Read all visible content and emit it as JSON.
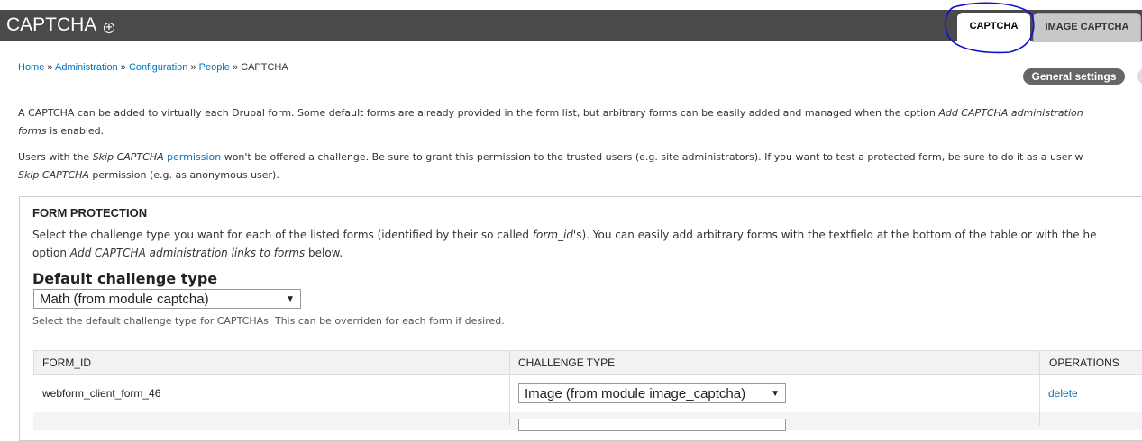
{
  "header": {
    "title": "CAPTCHA",
    "shortcut_icon": "plus-circle-icon",
    "tabs": [
      {
        "label": "CAPTCHA",
        "active": true
      },
      {
        "label": "IMAGE CAPTCHA",
        "active": false
      }
    ]
  },
  "breadcrumb": {
    "items": [
      "Home",
      "Administration",
      "Configuration",
      "People"
    ],
    "separator": "»",
    "current": "CAPTCHA"
  },
  "actions": {
    "general_settings": "General settings"
  },
  "intro": {
    "p1_a": "A CAPTCHA can be added to virtually each Drupal form. Some default forms are already provided in the form list, but arbitrary forms can be easily added and managed when the option ",
    "p1_em": "Add CAPTCHA administration",
    "p1_em2": "forms",
    "p1_b": " is enabled.",
    "p2_a": "Users with the ",
    "p2_em": "Skip CAPTCHA",
    "p2_link": "permission",
    "p2_b": " won't be offered a challenge. Be sure to grant this permission to the trusted users (e.g. site administrators). If you want to test a protected form, be sure to do it as a user w",
    "p2_em2": "Skip CAPTCHA",
    "p2_c": " permission (e.g. as anonymous user)."
  },
  "form_protection": {
    "legend": "FORM PROTECTION",
    "desc1_a": "Select the challenge type you want for each of the listed forms (identified by their so called ",
    "desc1_em": "form_id",
    "desc1_b": "'s). You can easily add arbitrary forms with the textfield at the bottom of the table or with the he",
    "desc2_a": "option ",
    "desc2_em": "Add CAPTCHA administration links to forms",
    "desc2_b": " below.",
    "default_label": "Default challenge type",
    "default_value": "Math (from module captcha)",
    "default_help": "Select the default challenge type for CAPTCHAs. This can be overriden for each form if desired."
  },
  "table": {
    "headers": [
      "FORM_ID",
      "CHALLENGE TYPE",
      "OPERATIONS"
    ],
    "rows": [
      {
        "form_id": "webform_client_form_46",
        "challenge": "Image (from module image_captcha)",
        "operation": "delete"
      }
    ]
  },
  "colors": {
    "header_bg": "#4a4a4a",
    "link": "#0074bd",
    "annotation": "#1010d0"
  }
}
